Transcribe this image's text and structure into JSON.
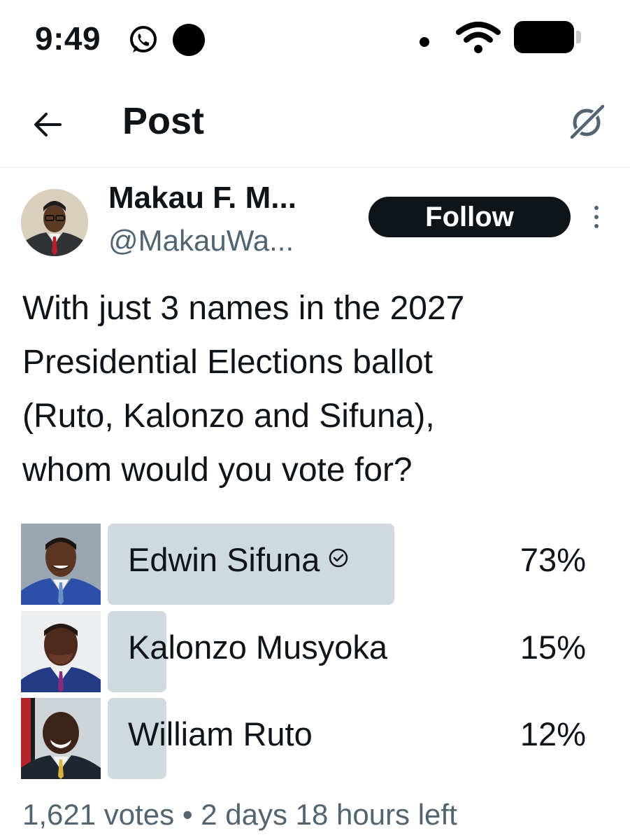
{
  "status_bar": {
    "time": "9:49",
    "icons": [
      "whatsapp-icon",
      "recording-dot",
      "location-dot",
      "wifi-icon",
      "battery-icon"
    ]
  },
  "header": {
    "title": "Post",
    "back_icon": "arrow-left-icon",
    "right_icon": "grok-icon"
  },
  "author": {
    "name": "Makau F. M...",
    "handle": "@MakauWa...",
    "follow_label": "Follow"
  },
  "tweet": {
    "line1": "With just 3 names in the 2027",
    "line2": "Presidential Elections ballot",
    "line3": "(Ruto, Kalonzo and Sifuna),",
    "line4": "whom would you vote for?"
  },
  "poll": {
    "options": [
      {
        "label": "Edwin Sifuna",
        "percent": "73%",
        "value": 73,
        "selected": true
      },
      {
        "label": "Kalonzo Musyoka",
        "percent": "15%",
        "value": 15,
        "selected": false
      },
      {
        "label": "William Ruto",
        "percent": "12%",
        "value": 12,
        "selected": false
      }
    ],
    "footer": "1,621 votes • 2 days 18 hours left"
  },
  "colors": {
    "text": "#0f1419",
    "secondary": "#536471",
    "poll_bar": "#cfd9de",
    "follow_bg": "#0f1419"
  }
}
